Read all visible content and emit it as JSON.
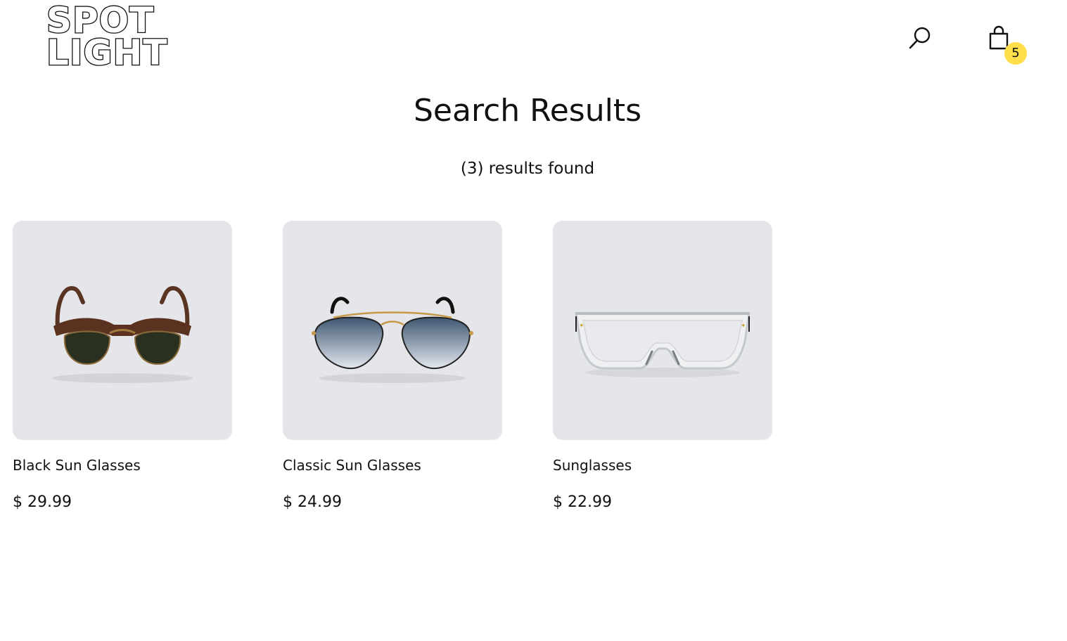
{
  "header": {
    "logo_line1": "SPOT",
    "logo_line2": "LIGHT",
    "search_icon": "search-icon",
    "cart_icon": "shopping-bag-icon",
    "cart_count": "5",
    "badge_color": "#ffe04a"
  },
  "main": {
    "title": "Search Results",
    "results_text": "(3) results found"
  },
  "products": [
    {
      "name": "Black Sun Glasses",
      "price": "$ 29.99",
      "image": "clubmaster-sunglasses-image"
    },
    {
      "name": "Classic Sun Glasses",
      "price": "$ 24.99",
      "image": "aviator-sunglasses-image"
    },
    {
      "name": "Sunglasses",
      "price": "$ 22.99",
      "image": "clear-shield-sunglasses-image"
    }
  ],
  "colors": {
    "card_background": "#e5e6e9",
    "text": "#111111"
  }
}
